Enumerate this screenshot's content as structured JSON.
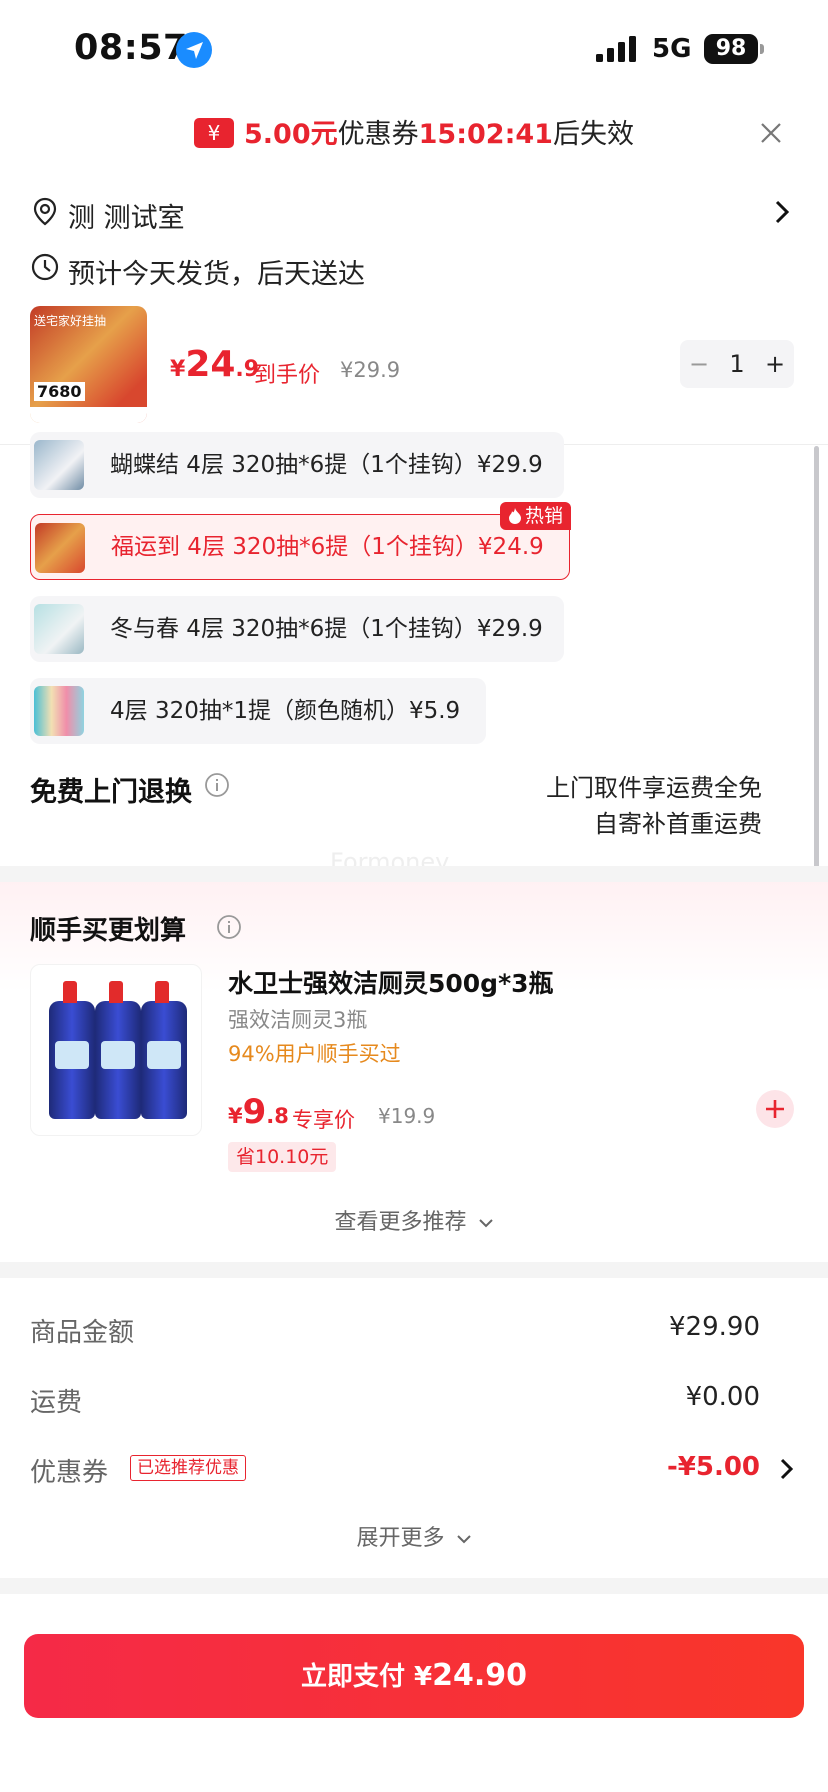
{
  "status_bar": {
    "time": "08:57",
    "network": "5G",
    "battery": "98"
  },
  "coupon_banner": {
    "amount": "5.00元",
    "label": "优惠券",
    "countdown": "15:02:41",
    "suffix": "后失效",
    "icon": "¥"
  },
  "address": {
    "text": "测 测试室"
  },
  "delivery": {
    "text": "预计今天发货，后天送达"
  },
  "product": {
    "thumb_top_text": "送宅家好挂抽",
    "thumb_count": "7680",
    "price_currency": "¥",
    "price_int": "24",
    "price_dec": ".9",
    "price_label": "到手价",
    "orig_price": "¥29.9",
    "quantity": "1",
    "minus": "−",
    "plus": "+"
  },
  "options": [
    {
      "label": "蝴蝶结 4层 320抽*6提（1个挂钩）¥29.9",
      "selected": false
    },
    {
      "label": "福运到 4层 320抽*6提（1个挂钩）¥24.9",
      "selected": true
    },
    {
      "label": "冬与春 4层 320抽*6提（1个挂钩）¥29.9",
      "selected": false
    },
    {
      "label": "4层 320抽*1提（颜色随机）¥5.9",
      "selected": false
    }
  ],
  "hot_badge": "热销",
  "returns": {
    "title": "免费上门退换",
    "line1": "上门取件享运费全免",
    "line2": "自寄补首重运费"
  },
  "watermark": "Formoney",
  "recommend": {
    "title": "顺手买更划算",
    "name": "水卫士强效洁厕灵500g*3瓶",
    "subtitle": "强效洁厕灵3瓶",
    "percent": "94%用户顺手买过",
    "price_currency": "¥",
    "price_int": "9",
    "price_dec": ".8",
    "price_label": "专享价",
    "orig_price": "¥19.9",
    "save": "省10.10元",
    "more": "查看更多推荐"
  },
  "totals": {
    "goods_label": "商品金额",
    "goods_value": "¥29.90",
    "shipping_label": "运费",
    "shipping_value": "¥0.00",
    "coupon_label": "优惠券",
    "coupon_badge": "已选推荐优惠",
    "coupon_value": "-¥5.00",
    "expand": "展开更多"
  },
  "pay": {
    "label": "立即支付 ¥",
    "amount": "24.90"
  },
  "colors": {
    "accent": "#e8242f",
    "orange": "#e6891d",
    "muted": "#888888"
  }
}
